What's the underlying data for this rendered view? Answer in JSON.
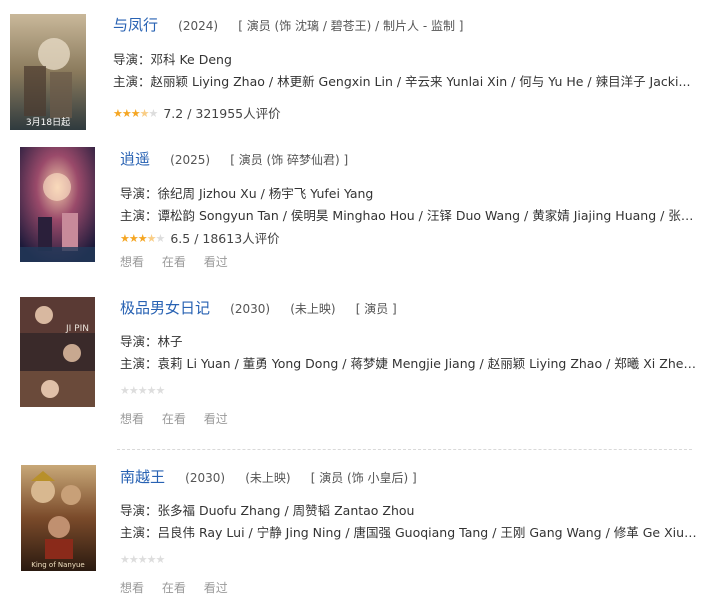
{
  "items": [
    {
      "title": "与凤行",
      "year": "(2024)",
      "status": "",
      "role": "[ 演员 (饰 沈璃 / 碧苍王) / 制片人 - 监制 ]",
      "director": "导演：邓科 Ke Deng",
      "cast": "主演：赵丽颖 Liying Zhao / 林更新 Gengxin Lin / 辛云来 Yunlai Xin / 何与 Yu He / 辣目洋子 Jacki...",
      "rating": "7.2 / 321955人评价",
      "stars": 3.5,
      "poster_text": "3月18日起",
      "actions": []
    },
    {
      "title": "逍遥",
      "year": "(2025)",
      "status": "",
      "role": "[ 演员 (饰 碎梦仙君) ]",
      "director": "导演：徐纪周 Jizhou Xu / 杨宇飞 Yufei Yang",
      "cast": "主演：谭松韵 Songyun Tan / 侯明昊 Minghao Hou / 汪铎 Duo Wang / 黄家婧 Jiajing Huang / 张小...",
      "rating": "6.5 / 18613人评价",
      "stars": 3.5,
      "poster_text": "",
      "actions": [
        "想看",
        "在看",
        "看过"
      ]
    },
    {
      "title": "极品男女日记",
      "year": "(2030)",
      "status": "(未上映)",
      "role": "[ 演员 ]",
      "director": "导演：林子",
      "cast": "主演：袁莉 Li Yuan / 董勇 Yong Dong / 蒋梦婕 Mengjie Jiang / 赵丽颖 Liying Zhao / 郑曦 Xi Zhen...",
      "rating": "",
      "stars": 0,
      "poster_text": "",
      "actions": [
        "想看",
        "在看",
        "看过"
      ]
    },
    {
      "title": "南越王",
      "year": "(2030)",
      "status": "(未上映)",
      "role": "[ 演员 (饰 小皇后) ]",
      "director": "导演：张多福 Duofu Zhang / 周赞韬 Zantao Zhou",
      "cast": "主演：吕良伟 Ray Lui / 宁静 Jing Ning / 唐国强 Guoqiang Tang / 王刚 Gang Wang / 修革 Ge Xiu /...",
      "rating": "",
      "stars": 0,
      "poster_text": "",
      "actions": [
        "想看",
        "在看",
        "看过"
      ]
    }
  ]
}
